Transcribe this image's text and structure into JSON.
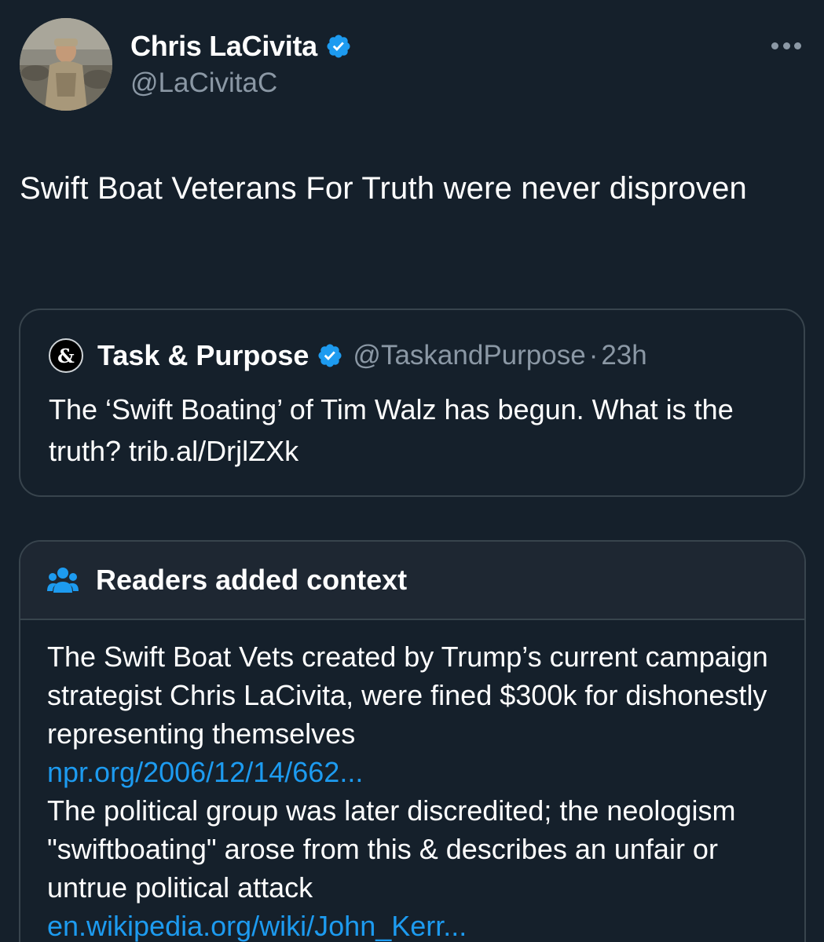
{
  "author": {
    "name": "Chris LaCivita",
    "handle": "@LaCivitaC"
  },
  "tweet": {
    "text": "Swift Boat Veterans For Truth were never disproven"
  },
  "quoted_tweet": {
    "logo_text": "&",
    "name": "Task & Purpose",
    "handle": "@TaskandPurpose",
    "separator": "·",
    "time": "23h",
    "text": "The ‘Swift Boating’ of Tim Walz has begun. What is the truth? trib.al/DrjlZXk"
  },
  "context_note": {
    "title": "Readers added context",
    "paragraph_1": "The Swift Boat Vets created by Trump’s current campaign strategist Chris LaCivita, were fined $300k for dishonestly representing themselves",
    "link_1": "npr.org/2006/12/14/662...",
    "paragraph_2": "The political group was later discredited; the neologism \"swiftboating\" arose from this & describes an unfair or untrue political attack",
    "link_2": "en.wikipedia.org/wiki/John_Kerr..."
  },
  "colors": {
    "background": "#15202b",
    "secondary_text": "#8b98a5",
    "link": "#1d9bf0",
    "verified": "#1d9bf0",
    "border": "#38444d"
  },
  "icons": {
    "verified": "verified-badge-icon",
    "more": "more-horizontal-icon",
    "context": "people-group-icon"
  }
}
